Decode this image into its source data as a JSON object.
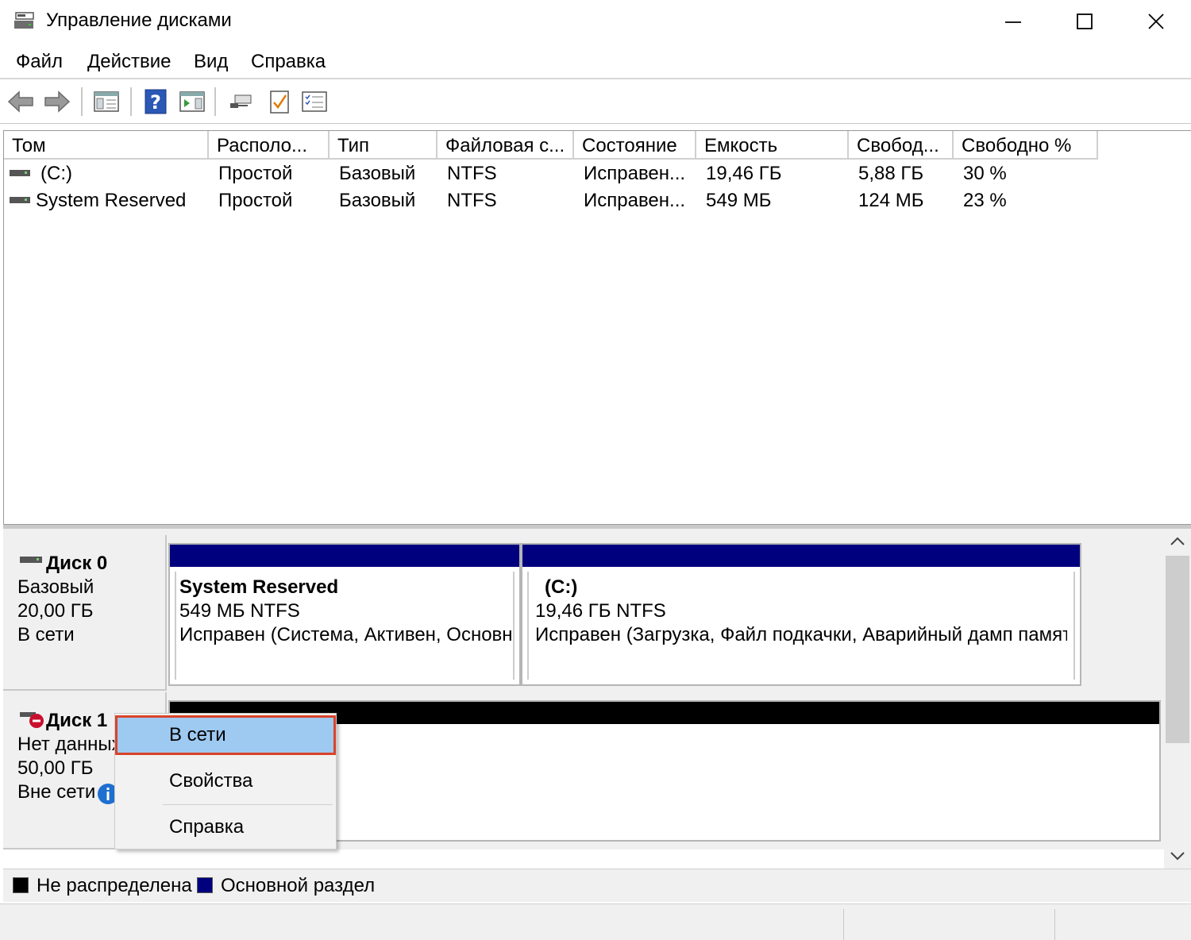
{
  "window": {
    "title": "Управление дисками"
  },
  "menu": [
    "Файл",
    "Действие",
    "Вид",
    "Справка"
  ],
  "toolbar": {
    "icons": [
      "back-arrow-icon",
      "forward-arrow-icon",
      "console-tree-icon",
      "help-icon",
      "action-pane-icon",
      "connect-icon",
      "check-icon",
      "properties-icon"
    ]
  },
  "volumes": {
    "headers": [
      "Том",
      "Располо...",
      "Тип",
      "Файловая с...",
      "Состояние",
      "Емкость",
      "Свобод...",
      "Свободно %"
    ],
    "rows": [
      [
        "(C:)",
        "Простой",
        "Базовый",
        "NTFS",
        "Исправен...",
        "19,46 ГБ",
        "5,88 ГБ",
        "30 %"
      ],
      [
        "System Reserved",
        "Простой",
        "Базовый",
        "NTFS",
        "Исправен...",
        "549 МБ",
        "124 МБ",
        "23 %"
      ]
    ]
  },
  "disks": [
    {
      "name": "Диск 0",
      "type": "Базовый",
      "size": "20,00 ГБ",
      "status": "В сети",
      "partitions": [
        {
          "name": "System Reserved",
          "size": "549 МБ NTFS",
          "status": "Исправен (Система, Активен, Основн"
        },
        {
          "name": "(C:)",
          "size": "19,46 ГБ NTFS",
          "status": "Исправен (Загрузка, Файл подкачки, Аварийный дамп памят"
        }
      ]
    },
    {
      "name": "Диск 1",
      "type": "Нет данных",
      "size": "50,00 ГБ",
      "status": "Вне сети"
    }
  ],
  "context_menu": [
    "В сети",
    "Свойства",
    "Справка"
  ],
  "legend": [
    {
      "label": "Не распределена",
      "color": "#000000"
    },
    {
      "label": "Основной раздел",
      "color": "#00007f"
    }
  ],
  "colors": {
    "primary_partition": "#00007f",
    "unallocated": "#000000",
    "highlight": "#9ec9f1",
    "highlight_border": "#d9432b"
  }
}
